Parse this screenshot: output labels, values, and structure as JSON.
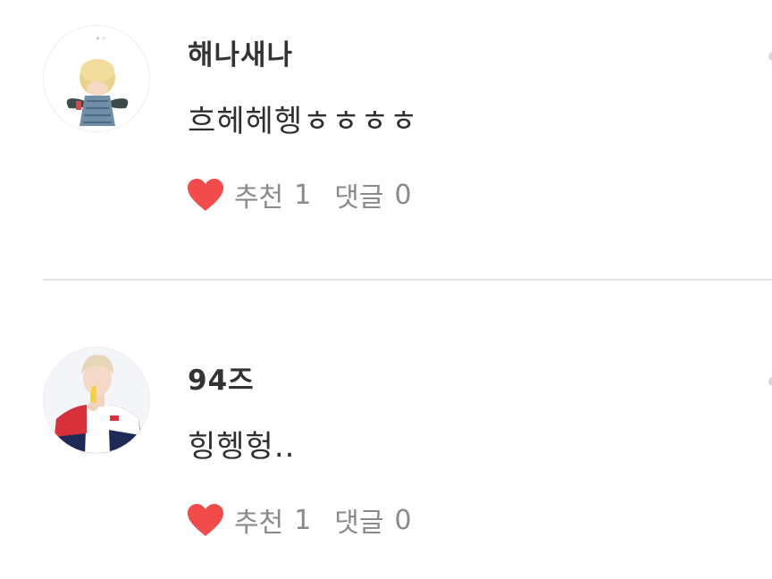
{
  "comments": [
    {
      "username": "해나새나",
      "content": "흐헤헤헹ㅎㅎㅎㅎ",
      "recommend_label": "추천",
      "recommend_count": "1",
      "reply_label": "댓글",
      "reply_count": "0",
      "avatar_icon": "avatar-angel-character-icon"
    },
    {
      "username": "94즈",
      "content": "힝헹헝..",
      "recommend_label": "추천",
      "recommend_count": "1",
      "reply_label": "댓글",
      "reply_count": "0",
      "avatar_icon": "avatar-person-photo-icon"
    }
  ],
  "colors": {
    "heart": "#f24b4b",
    "meta_text": "#8a8a8a",
    "divider": "#e6e6e6"
  }
}
